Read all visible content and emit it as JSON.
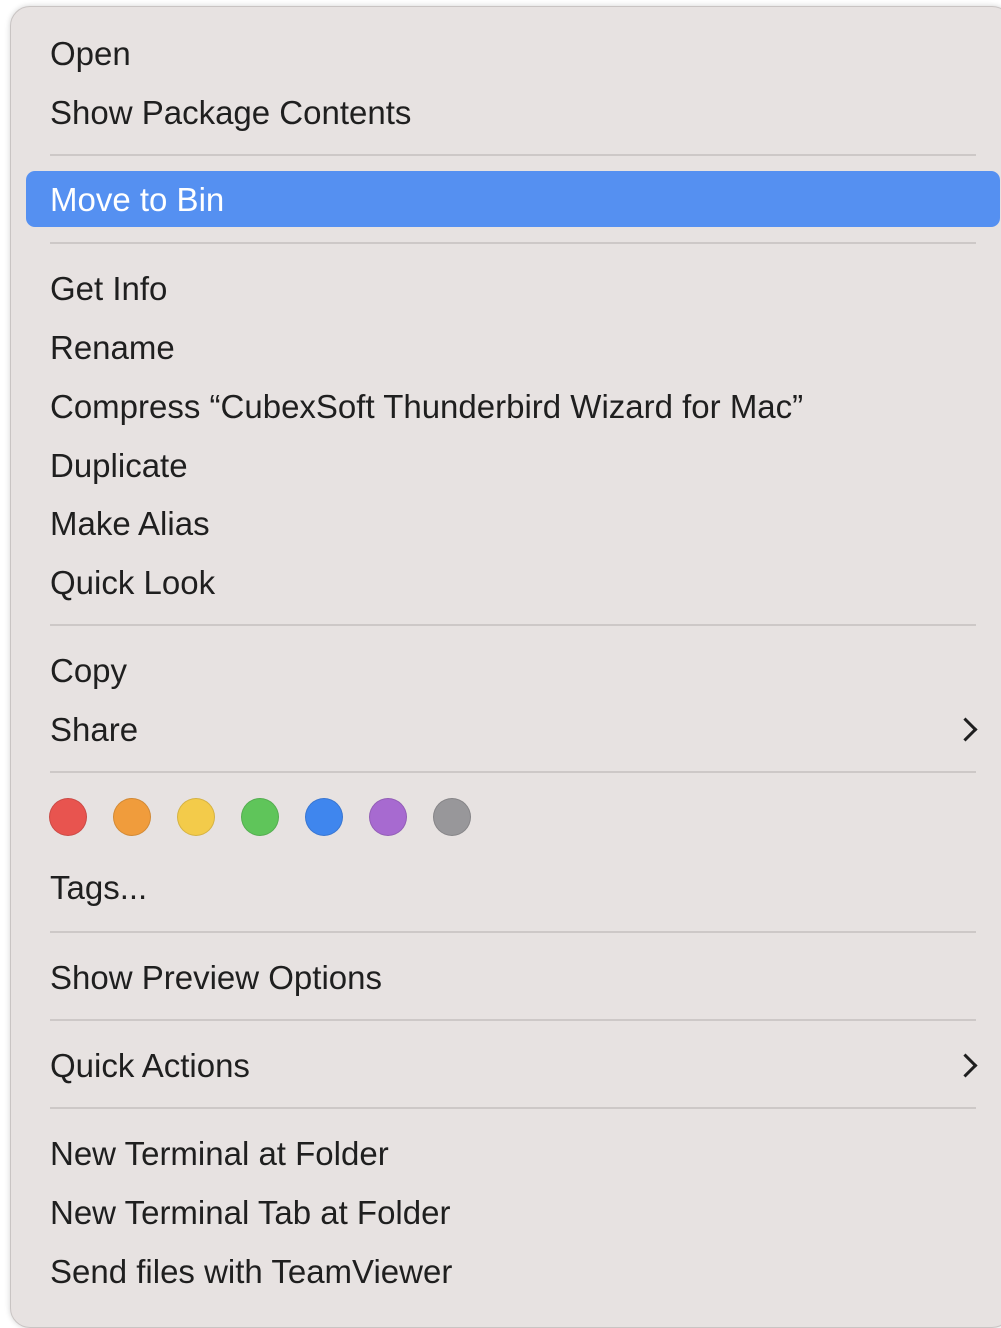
{
  "menu": {
    "open": "Open",
    "show_package_contents": "Show Package Contents",
    "move_to_bin": "Move to Bin",
    "get_info": "Get Info",
    "rename": "Rename",
    "compress": "Compress “CubexSoft Thunderbird Wizard for Mac”",
    "duplicate": "Duplicate",
    "make_alias": "Make Alias",
    "quick_look": "Quick Look",
    "copy": "Copy",
    "share": "Share",
    "tags": "Tags...",
    "show_preview_options": "Show Preview Options",
    "quick_actions": "Quick Actions",
    "new_terminal_at_folder": "New Terminal at Folder",
    "new_terminal_tab_at_folder": "New Terminal Tab at Folder",
    "send_files_teamviewer": "Send files with TeamViewer"
  },
  "icons": {
    "share_chevron": "chevron-right-icon",
    "quick_actions_chevron": "chevron-right-icon"
  },
  "tag_colors": [
    {
      "name": "red",
      "hex": "#e8544f"
    },
    {
      "name": "orange",
      "hex": "#f09c3c"
    },
    {
      "name": "yellow",
      "hex": "#f3cb4a"
    },
    {
      "name": "green",
      "hex": "#5fc55a"
    },
    {
      "name": "blue",
      "hex": "#3f86ee"
    },
    {
      "name": "purple",
      "hex": "#a76ad0"
    },
    {
      "name": "gray",
      "hex": "#98979a"
    }
  ],
  "colors": {
    "highlight": "#5590f1",
    "menu_background": "#e7e2e1"
  }
}
